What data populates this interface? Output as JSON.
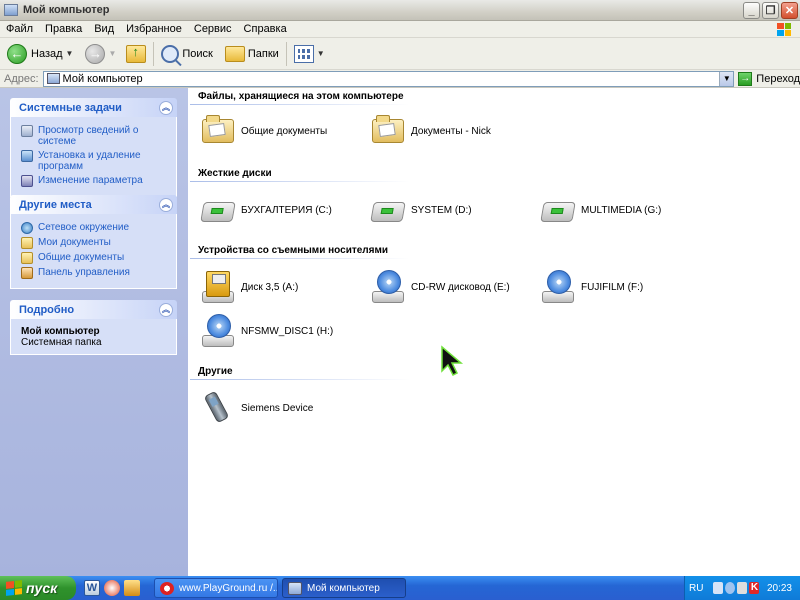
{
  "window": {
    "title": "Мой компьютер",
    "controls": [
      "minimize",
      "maximize",
      "close"
    ]
  },
  "menu": [
    "Файл",
    "Правка",
    "Вид",
    "Избранное",
    "Сервис",
    "Справка"
  ],
  "toolbar": {
    "back_label": "Назад",
    "search_label": "Поиск",
    "folders_label": "Папки"
  },
  "address": {
    "label": "Адрес:",
    "value": "Мой компьютер",
    "go_label": "Переход"
  },
  "tasks_panel": {
    "title": "Системные задачи",
    "items": [
      {
        "label": "Просмотр сведений о системе",
        "icon": "system-info-icon"
      },
      {
        "label": "Установка и удаление программ",
        "icon": "add-remove-icon"
      },
      {
        "label": "Изменение параметра",
        "icon": "settings-icon"
      }
    ]
  },
  "places_panel": {
    "title": "Другие места",
    "items": [
      {
        "label": "Сетевое окружение",
        "icon": "network-icon"
      },
      {
        "label": "Мои документы",
        "icon": "folder-icon"
      },
      {
        "label": "Общие документы",
        "icon": "folder-icon"
      },
      {
        "label": "Панель управления",
        "icon": "control-panel-icon"
      }
    ]
  },
  "details_panel": {
    "title": "Подробно",
    "name": "Мой компьютер",
    "subtitle": "Системная папка"
  },
  "groups": [
    {
      "title": "Файлы, хранящиеся на этом компьютере",
      "items": [
        {
          "label": "Общие документы",
          "icon": "shared-folder-icon"
        },
        {
          "label": "Документы - Nick",
          "icon": "user-folder-icon"
        }
      ]
    },
    {
      "title": "Жесткие диски",
      "items": [
        {
          "label": "БУХГАЛТЕРИЯ (C:)",
          "icon": "hard-drive-icon"
        },
        {
          "label": "SYSTEM (D:)",
          "icon": "hard-drive-icon"
        },
        {
          "label": "MULTIMEDIA (G:)",
          "icon": "hard-drive-icon"
        }
      ]
    },
    {
      "title": "Устройства со съемными носителями",
      "items": [
        {
          "label": "Диск 3,5 (A:)",
          "icon": "floppy-drive-icon"
        },
        {
          "label": "CD-RW дисковод (E:)",
          "icon": "cd-drive-icon"
        },
        {
          "label": "FUJIFILM (F:)",
          "icon": "cd-drive-icon"
        },
        {
          "label": "NFSMW_DISC1 (H:)",
          "icon": "cd-drive-icon"
        }
      ]
    },
    {
      "title": "Другие",
      "items": [
        {
          "label": "Siemens Device",
          "icon": "mobile-phone-icon"
        }
      ]
    }
  ],
  "taskbar": {
    "start_label": "пуск",
    "tasks": [
      {
        "label": "www.PlayGround.ru /...",
        "active": false
      },
      {
        "label": "Мой компьютер",
        "active": true
      }
    ],
    "language": "RU",
    "clock": "20:23"
  },
  "colors": {
    "taskpane_link": "#215dc6",
    "taskbar": "#2566d4",
    "start_button": "#2f922c",
    "close_button": "#d3502e"
  }
}
